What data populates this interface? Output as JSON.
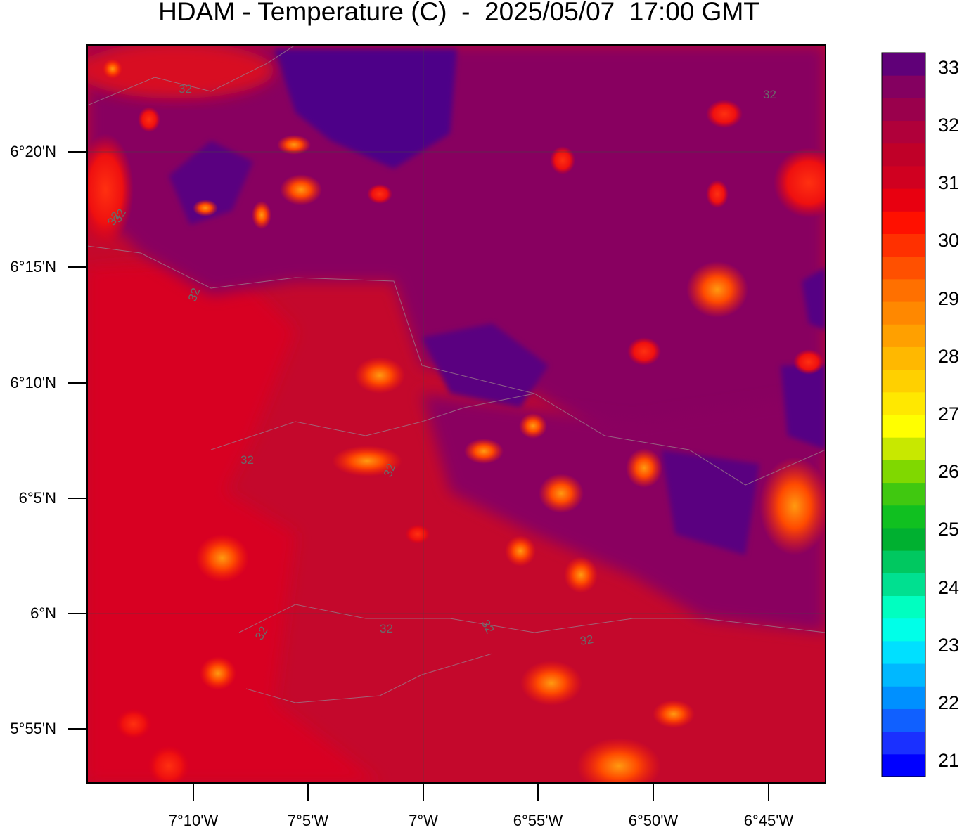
{
  "title": "HDAM - Temperature (C)  -  2025/05/07  17:00 GMT",
  "map": {
    "variable": "Temperature (C)",
    "lat_labels": [
      "6°20'N",
      "6°15'N",
      "6°10'N",
      "6°5'N",
      "6°N",
      "5°55'N"
    ],
    "lon_labels": [
      "7°10'W",
      "7°5'W",
      "7°W",
      "6°55'W",
      "6°50'W",
      "6°45'W"
    ],
    "contour_labels": [
      "32",
      "32",
      "32",
      "32",
      "32",
      "32",
      "32",
      "32",
      "32",
      "32",
      "32"
    ],
    "background_color": "#c8102e",
    "cool_region_color": "#7a0060",
    "coolest_color": "#4b0082"
  },
  "colorbar": {
    "min": 20.5,
    "max": 33.5,
    "labels": [
      "33",
      "32",
      "31",
      "30",
      "29",
      "28",
      "27",
      "26",
      "25",
      "24",
      "23",
      "22",
      "21"
    ],
    "colors": [
      "#0000ff",
      "#1a30ff",
      "#1060ff",
      "#0090ff",
      "#00b8ff",
      "#00e0ff",
      "#00ffe8",
      "#00ffc0",
      "#00e090",
      "#00c860",
      "#00b030",
      "#10c020",
      "#40c810",
      "#80d800",
      "#c8e800",
      "#ffff00",
      "#ffe800",
      "#ffd000",
      "#ffb800",
      "#ffa000",
      "#ff8800",
      "#ff7000",
      "#ff5000",
      "#ff3000",
      "#ff1000",
      "#e80010",
      "#d00020",
      "#c00028",
      "#b0003a",
      "#9a004c",
      "#840060",
      "#600078"
    ]
  }
}
